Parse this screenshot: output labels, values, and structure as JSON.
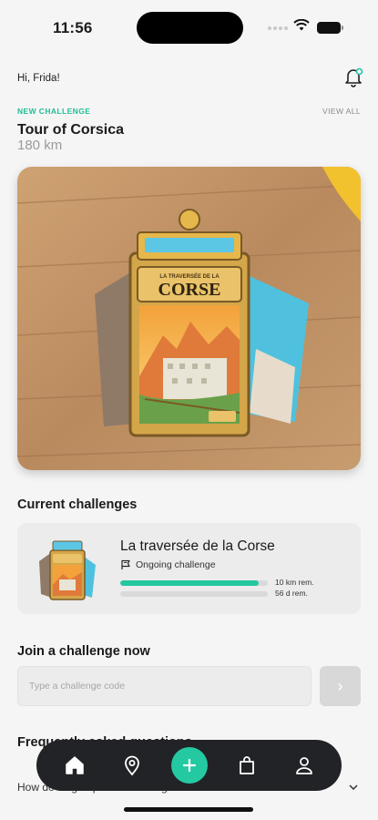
{
  "status_bar": {
    "time": "11:56"
  },
  "header": {
    "greeting": "Hi, Frida!"
  },
  "new_challenge": {
    "tag": "NEW CHALLENGE",
    "view_all": "VIEW ALL",
    "title": "Tour of Corsica",
    "distance": "180 km",
    "medal_text": "CORSE",
    "medal_banner": "LA TRAVERSÉE DE LA"
  },
  "current": {
    "heading": "Current challenges",
    "items": [
      {
        "title": "La traversée de la Corse",
        "status": "Ongoing challenge",
        "distance_progress": 0.94,
        "distance_label": "10 km rem.",
        "days_progress": 0.0,
        "days_label": "56 d rem."
      }
    ]
  },
  "join": {
    "heading": "Join a challenge now",
    "placeholder": "Type a challenge code",
    "button_glyph": "›"
  },
  "faq": {
    "heading": "Frequently asked questions",
    "items": [
      {
        "question": "How do I sign up for a challenge?"
      }
    ]
  },
  "tabbar": {
    "tabs": [
      {
        "icon": "home-icon",
        "active": true
      },
      {
        "icon": "map-pin-icon"
      },
      {
        "icon": "plus-icon"
      },
      {
        "icon": "shopping-bag-icon"
      },
      {
        "icon": "profile-icon"
      }
    ]
  },
  "colors": {
    "accent": "#23c7a0",
    "tabbar": "#222326",
    "background": "#f5f5f5"
  }
}
